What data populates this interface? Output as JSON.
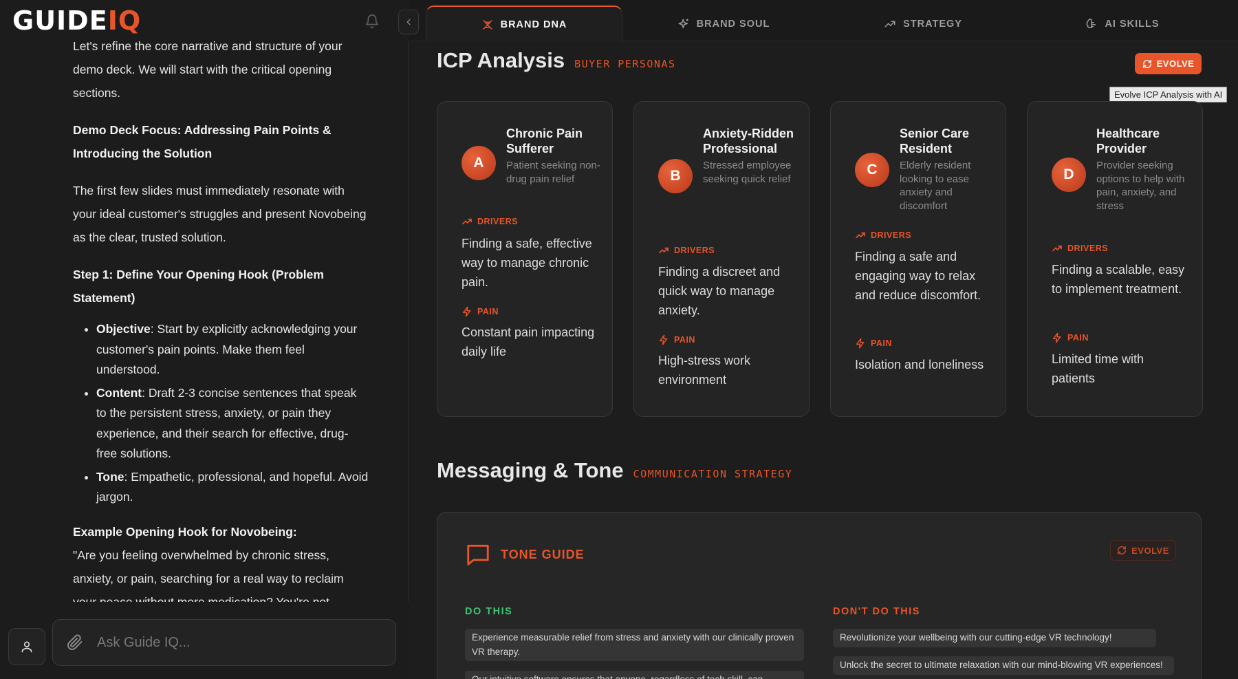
{
  "app": {
    "logo_main": "GUIDE",
    "logo_accent": "IQ"
  },
  "chat": {
    "intro_cut": "Let's refine the core narrative and structure of your",
    "intro_rest": "demo deck. We will start with the critical opening sections.",
    "focus_heading": "Demo Deck Focus: Addressing Pain Points & Introducing the Solution",
    "paragraph": "The first few slides must immediately resonate with your ideal customer's struggles and present Novobeing as the clear, trusted solution.",
    "step_heading": "Step 1: Define Your Opening Hook (Problem Statement)",
    "bullets": [
      {
        "label": "Objective",
        "text": ": Start by explicitly acknowledging your customer's pain points. Make them feel understood."
      },
      {
        "label": "Content",
        "text": ": Draft 2-3 concise sentences that speak to the persistent stress, anxiety, or pain they experience, and their search for effective, drug-free solutions."
      },
      {
        "label": "Tone",
        "text": ": Empathetic, professional, and hopeful. Avoid jargon."
      }
    ],
    "example_heading": "Example Opening Hook for Novobeing:",
    "example_text": "\"Are you feeling overwhelmed by chronic stress, anxiety, or pain, searching for a real way to reclaim your peace without more medication? You're not alone...",
    "input_placeholder": "Ask Guide IQ..."
  },
  "tabs": [
    {
      "label": "BRAND DNA",
      "icon": "dna-icon",
      "active": true
    },
    {
      "label": "BRAND SOUL",
      "icon": "sparkle-icon",
      "active": false
    },
    {
      "label": "STRATEGY",
      "icon": "trending-icon",
      "active": false
    },
    {
      "label": "AI SKILLS",
      "icon": "brain-icon",
      "active": false
    }
  ],
  "icp": {
    "title": "ICP Analysis",
    "subtitle": "BUYER PERSONAS",
    "evolve_label": "EVOLVE",
    "tooltip": "Evolve ICP Analysis with AI",
    "drivers_label": "DRIVERS",
    "pain_label": "PAIN",
    "personas": [
      {
        "letter": "A",
        "name": "Chronic Pain Sufferer",
        "desc": "Patient seeking non-drug pain relief",
        "drivers": "Finding a safe, effective way to manage chronic pain.",
        "pain": "Constant pain impacting daily life"
      },
      {
        "letter": "B",
        "name": "Anxiety-Ridden Professional",
        "desc": "Stressed employee seeking quick relief",
        "drivers": "Finding a discreet and quick way to manage anxiety.",
        "pain": "High-stress work environment"
      },
      {
        "letter": "C",
        "name": "Senior Care Resident",
        "desc": "Elderly resident looking to ease anxiety and discomfort",
        "drivers": "Finding a safe and engaging way to relax and reduce discomfort.",
        "pain": "Isolation and loneliness"
      },
      {
        "letter": "D",
        "name": "Healthcare Provider",
        "desc": "Provider seeking options to help with pain, anxiety, and stress",
        "drivers": "Finding a scalable, easy to implement treatment.",
        "pain": "Limited time with patients"
      }
    ]
  },
  "messaging": {
    "title": "Messaging & Tone",
    "subtitle": "COMMUNICATION STRATEGY",
    "tone_guide_label": "TONE GUIDE",
    "evolve_label": "EVOLVE",
    "do_heading": "DO THIS",
    "dont_heading": "DON'T DO THIS",
    "do_items": [
      "Experience measurable relief from stress and anxiety with our clinically proven VR therapy.",
      "Our intuitive software ensures that anyone, regardless of tech skill, can"
    ],
    "dont_items": [
      "Revolutionize your wellbeing with our cutting-edge VR technology!",
      "Unlock the secret to ultimate relaxation with our mind-blowing VR experiences!"
    ]
  },
  "colors": {
    "accent": "#e8552a",
    "do_green": "#3fc473",
    "background": "#1c1c1c",
    "card": "#242424"
  }
}
